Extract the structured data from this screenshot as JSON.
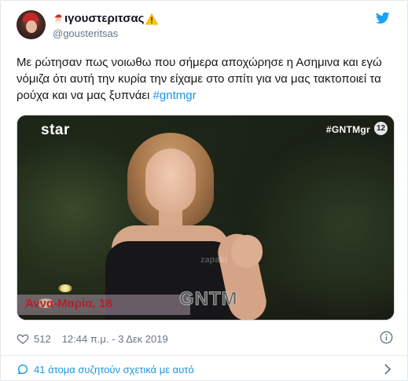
{
  "tweet": {
    "display_name": "ιγουστεριτσας",
    "display_name_prefix_icon": "santa-face-icon",
    "display_name_suffix_icon": "warning-icon",
    "handle": "@gousteritsas",
    "text_before_hashtag": "Με ρώτησαν πως νοιωθω που σήμερα αποχώρησε η Ασημινα και εγώ νόμιζα ότι αυτή την κυρία την είχαμε στο σπίτι για να μας τακτοποιεί τα ρούχα και να μας ξυπνάει ",
    "hashtag": "#gntmgr",
    "likes": "512",
    "timestamp": "12:44 π.μ. - 3 Δεκ 2019",
    "discussion": "41 άτομα συζητούν σχετικά με αυτό"
  },
  "media": {
    "channel_logo": "star",
    "show_tag": "#GNTMgr",
    "rating": "12",
    "lower_third_name": "Άννα-Μαρία, 18",
    "show_logo": "GNTM",
    "watermark": "zapaki"
  },
  "colors": {
    "accent": "#1b95e0",
    "text": "#14171a",
    "muted": "#657786",
    "twitter_blue": "#1da1f2"
  }
}
